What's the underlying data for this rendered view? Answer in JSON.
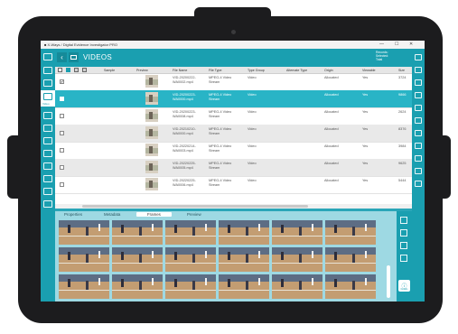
{
  "app": {
    "title": "■ X-Ways / Digital Evidence Investigator PRO",
    "win_min": "—",
    "win_max": "☐",
    "win_close": "✕"
  },
  "header": {
    "back_icon": "‹",
    "section_title": "VIDEOS",
    "records_label": "Records:",
    "selected_label": "Selected:",
    "total_label": "Total"
  },
  "left_rail": {
    "selected_label": "Video"
  },
  "table": {
    "columns": [
      "Preview",
      "File Name",
      "File Type",
      "Type Group",
      "Alternate Type",
      "Origin",
      "Viewable",
      "Size"
    ],
    "header_extra": "Sample",
    "rows": [
      {
        "file": [
          "VID-20200222-",
          "WA0002.mp4"
        ],
        "type": [
          "MPEG-4 Video",
          "Stream"
        ],
        "group": "Video",
        "origin": "Allocated",
        "viewable": "Yes",
        "size": "3724",
        "checked": "✔"
      },
      {
        "file": [
          "VID-20200223-",
          "WA0000.mp4"
        ],
        "type": [
          "MPEG-4 Video",
          "Stream"
        ],
        "group": "Video",
        "origin": "Allocated",
        "viewable": "Yes",
        "size": "9866",
        "checked": ""
      },
      {
        "file": [
          "VID-20200223-",
          "WA0008.mp4"
        ],
        "type": [
          "MPEG-4 Video",
          "Stream"
        ],
        "group": "Video",
        "origin": "Allocated",
        "viewable": "Yes",
        "size": "2624",
        "checked": ""
      },
      {
        "file": [
          "VID-20210210-",
          "WA0000.mp4"
        ],
        "type": [
          "MPEG-4 Video",
          "Stream"
        ],
        "group": "Video",
        "origin": "Allocated",
        "viewable": "Yes",
        "size": "8376",
        "checked": ""
      },
      {
        "file": [
          "VID-20220214-",
          "WA0003.mp4"
        ],
        "type": [
          "MPEG-4 Video",
          "Stream"
        ],
        "group": "Video",
        "origin": "Allocated",
        "viewable": "Yes",
        "size": "3984",
        "checked": ""
      },
      {
        "file": [
          "VID-20220225-",
          "WA0005.mp4"
        ],
        "type": [
          "MPEG-4 Video",
          "Stream"
        ],
        "group": "Video",
        "origin": "Allocated",
        "viewable": "Yes",
        "size": "9625",
        "checked": ""
      },
      {
        "file": [
          "VID-20220225-",
          "WA0006.mp4"
        ],
        "type": [
          "MPEG-4 Video",
          "Stream"
        ],
        "group": "Video",
        "origin": "Allocated",
        "viewable": "Yes",
        "size": "5444",
        "checked": ""
      }
    ]
  },
  "detail_tabs": [
    "Properties",
    "Metadata",
    "Frames",
    "Preview"
  ],
  "active_tab": "Frames",
  "info_button": {
    "icon": "ⓘ",
    "label": "Details"
  },
  "colors": {
    "accent": "#1a9fb0",
    "selected_row": "#29b4c6",
    "panel_bg": "#9ed9e3"
  }
}
